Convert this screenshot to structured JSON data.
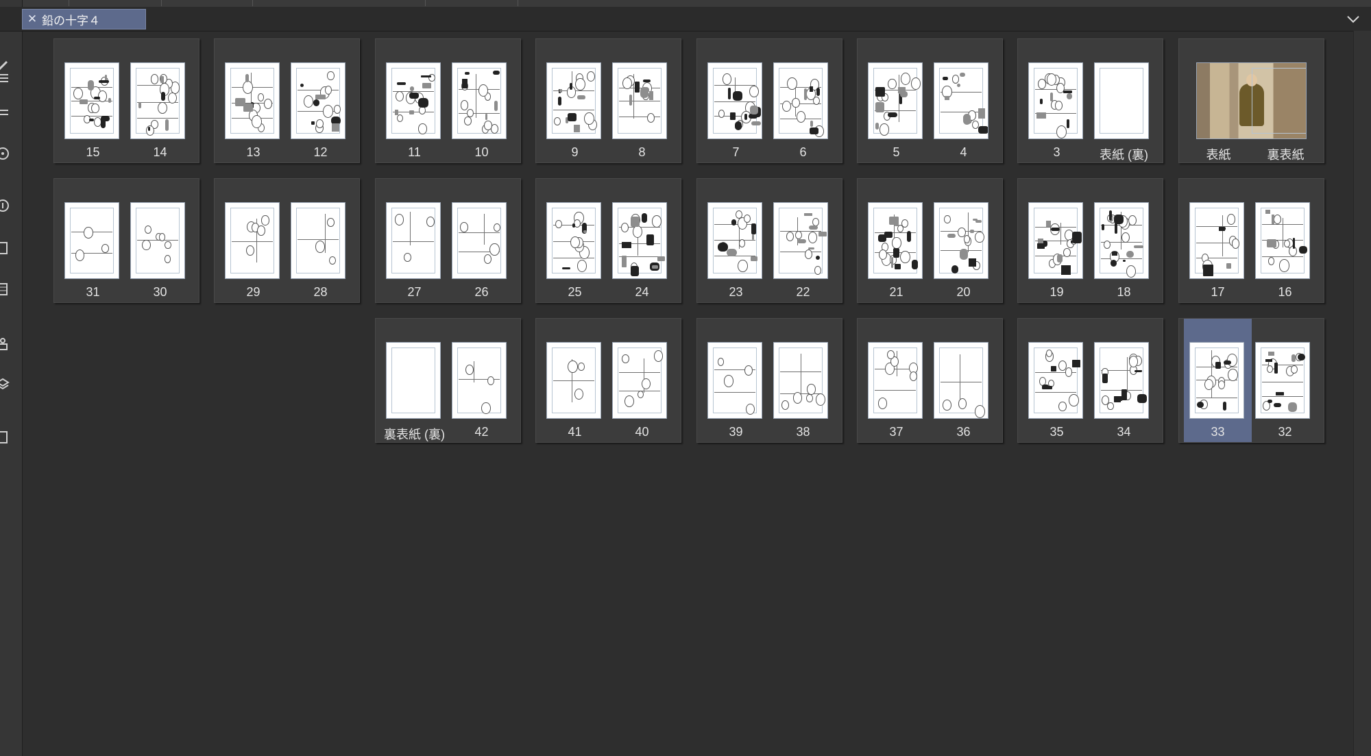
{
  "document_tab": {
    "title": "鉛の十字４",
    "close_icon": "close-icon"
  },
  "toolbar": {
    "collapse_icon": "chevron-down-icon"
  },
  "left_toolbar_icons": [
    "search-icon",
    "brush-icon",
    "adjust-icon",
    "navigator-icon",
    "info-icon",
    "material-icon",
    "timeline-icon",
    "layer-property-icon",
    "layers-icon",
    "page-icon"
  ],
  "selected_page": "33",
  "spreads": [
    {
      "row": 0,
      "col": 0,
      "left": "15",
      "right": "14",
      "kind": "manga"
    },
    {
      "row": 0,
      "col": 1,
      "left": "13",
      "right": "12",
      "kind": "manga"
    },
    {
      "row": 0,
      "col": 2,
      "left": "11",
      "right": "10",
      "kind": "manga"
    },
    {
      "row": 0,
      "col": 3,
      "left": "9",
      "right": "8",
      "kind": "manga"
    },
    {
      "row": 0,
      "col": 4,
      "left": "7",
      "right": "6",
      "kind": "manga"
    },
    {
      "row": 0,
      "col": 5,
      "left": "5",
      "right": "4",
      "kind": "manga"
    },
    {
      "row": 0,
      "col": 6,
      "left": "3",
      "right": "表紙 (裏)",
      "kind": "manga-blank"
    },
    {
      "row": 0,
      "col": 7,
      "left": "表紙",
      "right": "裏表紙",
      "kind": "cover"
    },
    {
      "row": 1,
      "col": 0,
      "left": "31",
      "right": "30",
      "kind": "sketch"
    },
    {
      "row": 1,
      "col": 1,
      "left": "29",
      "right": "28",
      "kind": "sketch"
    },
    {
      "row": 1,
      "col": 2,
      "left": "27",
      "right": "26",
      "kind": "sketch"
    },
    {
      "row": 1,
      "col": 3,
      "left": "25",
      "right": "24",
      "kind": "manga"
    },
    {
      "row": 1,
      "col": 4,
      "left": "23",
      "right": "22",
      "kind": "manga"
    },
    {
      "row": 1,
      "col": 5,
      "left": "21",
      "right": "20",
      "kind": "manga"
    },
    {
      "row": 1,
      "col": 6,
      "left": "19",
      "right": "18",
      "kind": "manga"
    },
    {
      "row": 1,
      "col": 7,
      "left": "17",
      "right": "16",
      "kind": "manga"
    },
    {
      "row": 2,
      "col": 2,
      "left": "裏表紙 (裏)",
      "right": "42",
      "kind": "blank-sketch"
    },
    {
      "row": 2,
      "col": 3,
      "left": "41",
      "right": "40",
      "kind": "sketch"
    },
    {
      "row": 2,
      "col": 4,
      "left": "39",
      "right": "38",
      "kind": "sketch"
    },
    {
      "row": 2,
      "col": 5,
      "left": "37",
      "right": "36",
      "kind": "sketch"
    },
    {
      "row": 2,
      "col": 6,
      "left": "35",
      "right": "34",
      "kind": "manga"
    },
    {
      "row": 2,
      "col": 7,
      "left": "33",
      "right": "32",
      "kind": "manga"
    }
  ],
  "colors": {
    "background": "#2e2e2e",
    "spread": "#3c3c3c",
    "selection": "#5d6a8c"
  }
}
